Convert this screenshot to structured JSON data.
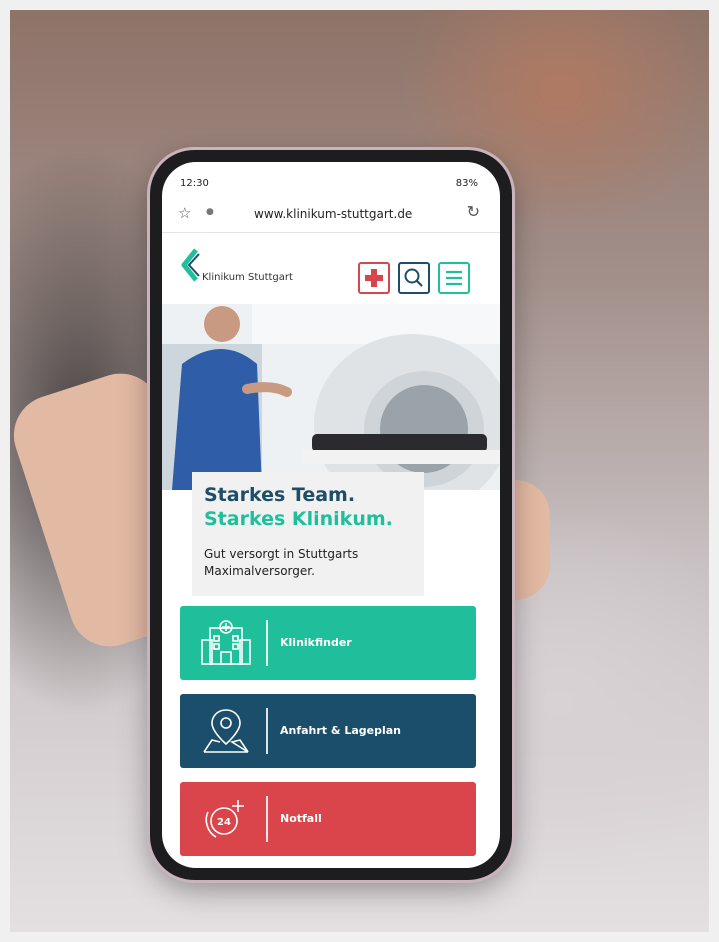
{
  "colors": {
    "teal": "#1fbf9c",
    "navy": "#1a4e6a",
    "red": "#d9454a",
    "headline_navy": "#1e4d68"
  },
  "status_bar": {
    "time": "12:30",
    "battery": "83%"
  },
  "browser": {
    "url": "www.klinikum-stuttgart.de"
  },
  "site_header": {
    "logo_text": "Klinikum Stuttgart",
    "buttons": [
      "first-aid-icon",
      "search-icon",
      "menu-icon"
    ]
  },
  "hero": {
    "headline_1": "Starkes Team.",
    "headline_2": "Starkes Klinikum.",
    "subtitle": "Gut versorgt in Stuttgarts Maximalversorger."
  },
  "actions": [
    {
      "label": "Klinikfinder",
      "icon": "hospital-building-icon"
    },
    {
      "label": "Anfahrt & Lageplan",
      "icon": "map-pin-icon"
    },
    {
      "label": "Notfall",
      "icon": "emergency-24-phone-icon"
    }
  ]
}
